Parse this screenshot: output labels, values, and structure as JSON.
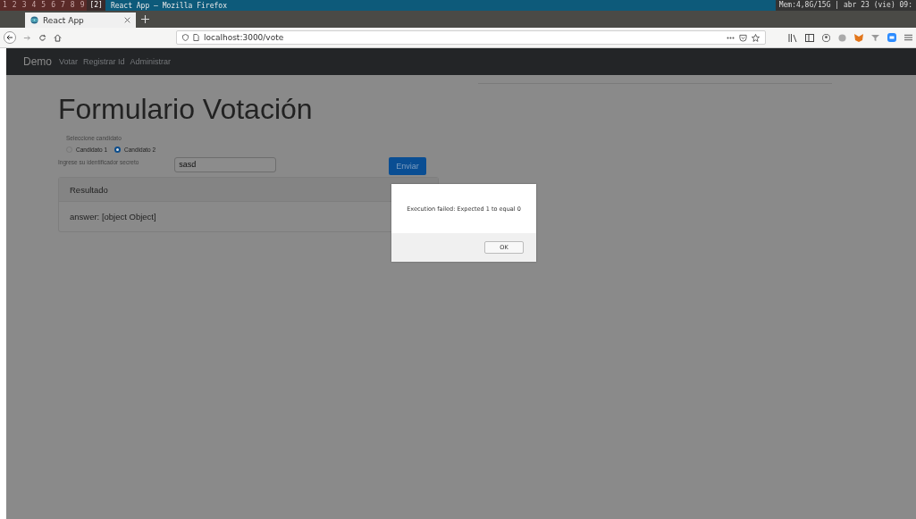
{
  "system_bar": {
    "workspaces": [
      {
        "label": "1",
        "selected": false
      },
      {
        "label": "2",
        "selected": false
      },
      {
        "label": "3",
        "selected": false
      },
      {
        "label": "4",
        "selected": false
      },
      {
        "label": "5",
        "selected": false
      },
      {
        "label": "6",
        "selected": false
      },
      {
        "label": "7",
        "selected": false
      },
      {
        "label": "8",
        "selected": false
      },
      {
        "label": "9",
        "selected": false
      },
      {
        "label": "[2]",
        "selected": true
      }
    ],
    "window_title": "React App — Mozilla Firefox",
    "status": "Mem:4,8G/15G | abr 23 (vie) 09:"
  },
  "browser": {
    "tabs": [
      {
        "label": "React App",
        "selected": true
      }
    ],
    "url": "localhost:3000/vote"
  },
  "navbar": {
    "brand": "Demo",
    "links": [
      "Votar",
      "Registrar Id",
      "Administrar"
    ]
  },
  "form": {
    "title": "Formulario Votación",
    "candidate_label": "Seleccione candidato",
    "candidates": [
      {
        "label": "Candidato 1",
        "selected": false
      },
      {
        "label": "Candidato 2",
        "selected": true
      }
    ],
    "secret_label": "Ingrese su identificador secreto",
    "secret_value": "sasd",
    "submit": "Enviar"
  },
  "result": {
    "title": "Resultado",
    "text": "answer: [object Object]"
  },
  "dialog": {
    "message": "Execution failed: Expected 1 to equal 0",
    "button": "OK"
  }
}
